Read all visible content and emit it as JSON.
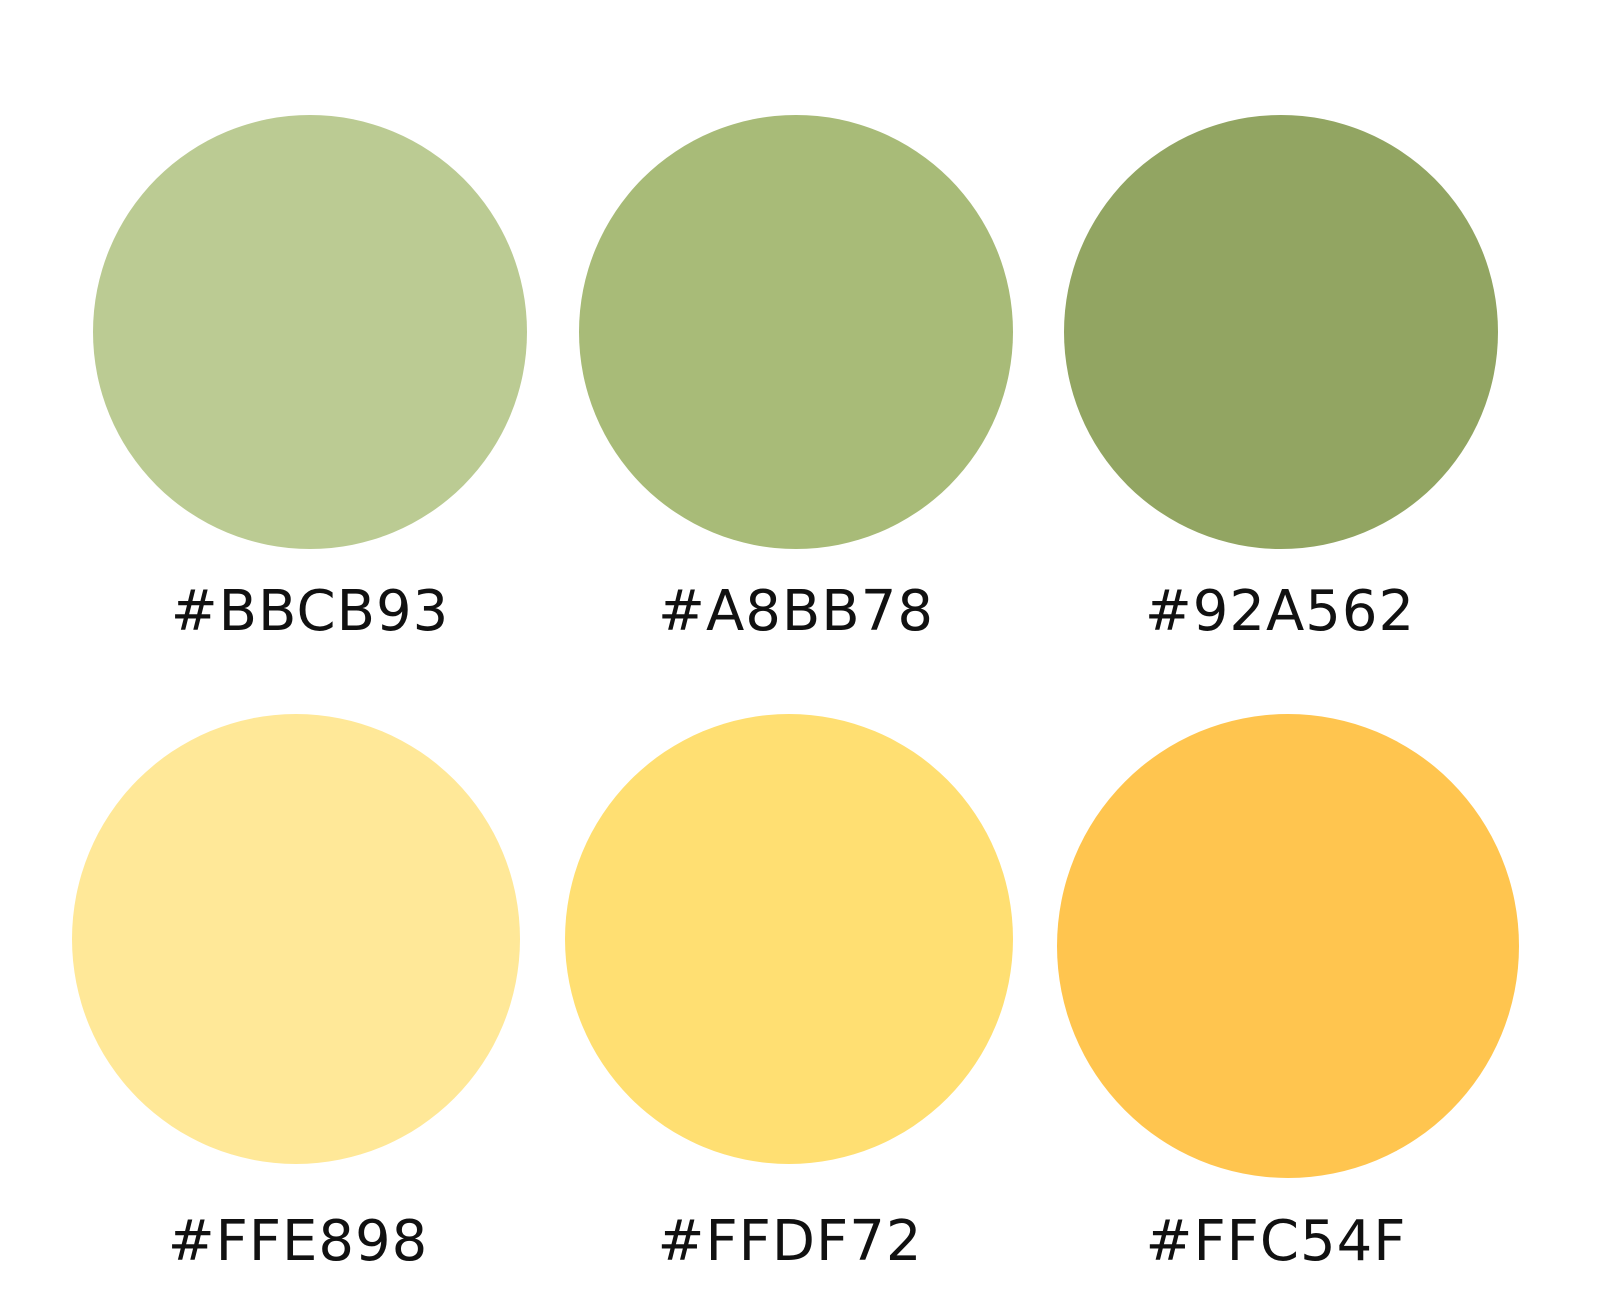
{
  "swatches": [
    {
      "code": "#BBCB93",
      "color": "#BBCB93"
    },
    {
      "code": "#A8BB78",
      "color": "#A8BB78"
    },
    {
      "code": "#92A562",
      "color": "#92A562"
    },
    {
      "code": "#FFE898",
      "color": "#FFE898"
    },
    {
      "code": "#FFDF72",
      "color": "#FFDF72"
    },
    {
      "code": "#FFC54F",
      "color": "#FFC54F"
    }
  ]
}
